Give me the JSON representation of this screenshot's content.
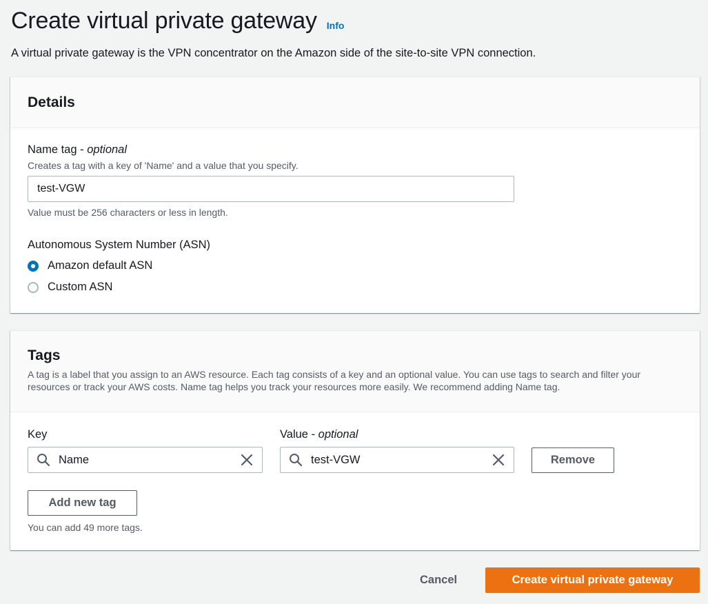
{
  "header": {
    "title": "Create virtual private gateway",
    "info_label": "Info",
    "description": "A virtual private gateway is the VPN concentrator on the Amazon side of the site-to-site VPN connection."
  },
  "details": {
    "title": "Details",
    "name_tag": {
      "label": "Name tag",
      "optional": "optional",
      "description": "Creates a tag with a key of 'Name' and a value that you specify.",
      "value": "test-VGW",
      "constraint": "Value must be 256 characters or less in length."
    },
    "asn": {
      "label": "Autonomous System Number (ASN)",
      "options": [
        {
          "label": "Amazon default ASN",
          "checked": true
        },
        {
          "label": "Custom ASN",
          "checked": false
        }
      ]
    }
  },
  "tags": {
    "title": "Tags",
    "description": "A tag is a label that you assign to an AWS resource. Each tag consists of a key and an optional value. You can use tags to search and filter your resources or track your AWS costs. Name tag helps you track your resources more easily. We recommend adding Name tag.",
    "key_label": "Key",
    "value_label": "Value",
    "value_optional": "optional",
    "rows": [
      {
        "key": "Name",
        "value": "test-VGW"
      }
    ],
    "remove_label": "Remove",
    "add_label": "Add new tag",
    "remaining": "You can add 49 more tags."
  },
  "footer": {
    "cancel_label": "Cancel",
    "submit_label": "Create virtual private gateway"
  },
  "colors": {
    "primary": "#ec7211",
    "link": "#0073bb",
    "radio_checked": "#0073bb"
  }
}
